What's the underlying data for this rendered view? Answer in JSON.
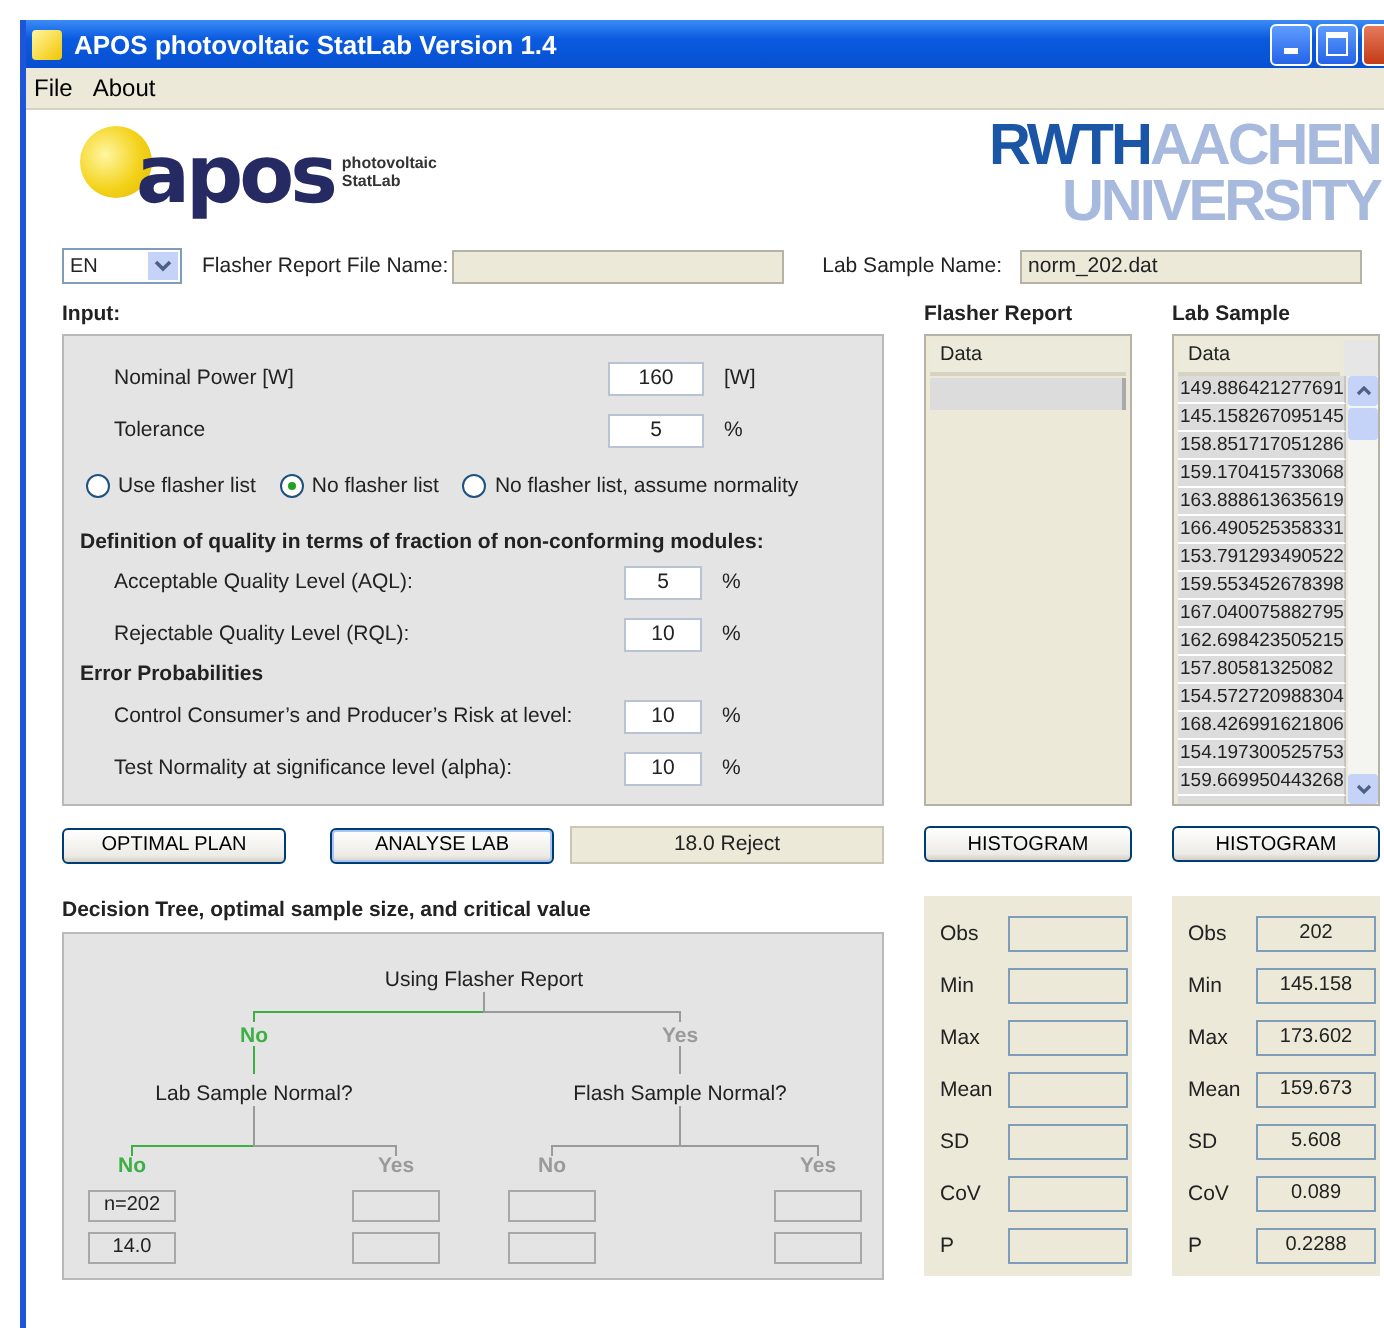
{
  "window": {
    "title": "APOS photovoltaic StatLab Version 1.4"
  },
  "menu": [
    "File",
    "About"
  ],
  "logos": {
    "apos": {
      "wordmark": "apos",
      "tagline_1": "photovoltaic",
      "tagline_2": "StatLab"
    },
    "rwth": {
      "part_1": "RWTH",
      "part_2": "AACHEN",
      "part_3": "UNIVERSITY"
    }
  },
  "files": {
    "language": "EN",
    "flasher_label": "Flasher Report File Name:",
    "lab_label": "Lab Sample Name:",
    "lab_value": "norm_202.dat"
  },
  "input": {
    "heading": "Input:",
    "fields": [
      {
        "label": "Nominal Power [W]",
        "value": "160",
        "unit": "[W]"
      },
      {
        "label": "Tolerance",
        "value": "5",
        "unit": "%"
      }
    ],
    "radios": [
      {
        "label": "Use flasher list",
        "selected": false
      },
      {
        "label": "No flasher list",
        "selected": true
      },
      {
        "label": "No flasher list, assume normality",
        "selected": false
      }
    ],
    "quality_heading": "Definition of quality in terms of fraction of non-conforming modules:",
    "quality_fields": [
      {
        "label": "Acceptable Quality Level (AQL):",
        "value": "5",
        "unit": "%"
      },
      {
        "label": "Rejectable Quality Level (RQL):",
        "value": "10",
        "unit": "%"
      }
    ],
    "error_heading": "Error Probabilities",
    "error_fields": [
      {
        "label": "Control Consumer’s and Producer’s Risk at level:",
        "value": "10",
        "unit": "%"
      },
      {
        "label": "Test Normality at significance level (alpha):",
        "value": "10",
        "unit": "%"
      }
    ]
  },
  "flasher_report": {
    "heading": "Flasher Report",
    "column": "Data",
    "button": "HISTOGRAM"
  },
  "lab_sample": {
    "heading": "Lab Sample",
    "column": "Data",
    "button": "HISTOGRAM",
    "rows": [
      "149.886421277691",
      "145.158267095145",
      "158.851717051286",
      "159.170415733068",
      "163.888613635619",
      "166.490525358331",
      "153.791293490522",
      "159.553452678398",
      "167.040075882795",
      "162.698423505215",
      "157.80581325082",
      "154.572720988304",
      "168.426991621806",
      "154.197300525753",
      "159.669950443268"
    ]
  },
  "actions": {
    "optimal_plan": "OPTIMAL PLAN",
    "analyse_lab": "ANALYSE LAB",
    "result": "18.0 Reject"
  },
  "tree": {
    "heading": "Decision Tree, optimal sample size, and critical value",
    "label": "Using Flasher Report",
    "children": [
      {
        "label": "No",
        "active": true,
        "node": "Lab Sample Normal?",
        "children": [
          {
            "label": "No",
            "active": true,
            "outputs": [
              "n=202",
              "14.0"
            ]
          },
          {
            "label": "Yes",
            "active": false
          }
        ]
      },
      {
        "label": "Yes",
        "active": false,
        "node": "Flash Sample Normal?",
        "children": [
          {
            "label": "No",
            "active": false
          },
          {
            "label": "Yes",
            "active": false
          }
        ]
      }
    ]
  },
  "flasher_stats": [
    {
      "label": "Obs"
    },
    {
      "label": "Min"
    },
    {
      "label": "Max"
    },
    {
      "label": "Mean"
    },
    {
      "label": "SD"
    },
    {
      "label": "CoV"
    },
    {
      "label": "P"
    }
  ],
  "lab_stats": [
    {
      "label": "Obs",
      "value": "202"
    },
    {
      "label": "Min",
      "value": "145.158"
    },
    {
      "label": "Max",
      "value": "173.602"
    },
    {
      "label": "Mean",
      "value": "159.673"
    },
    {
      "label": "SD",
      "value": "5.608"
    },
    {
      "label": "CoV",
      "value": "0.089"
    },
    {
      "label": "P",
      "value": "0.2288"
    }
  ]
}
